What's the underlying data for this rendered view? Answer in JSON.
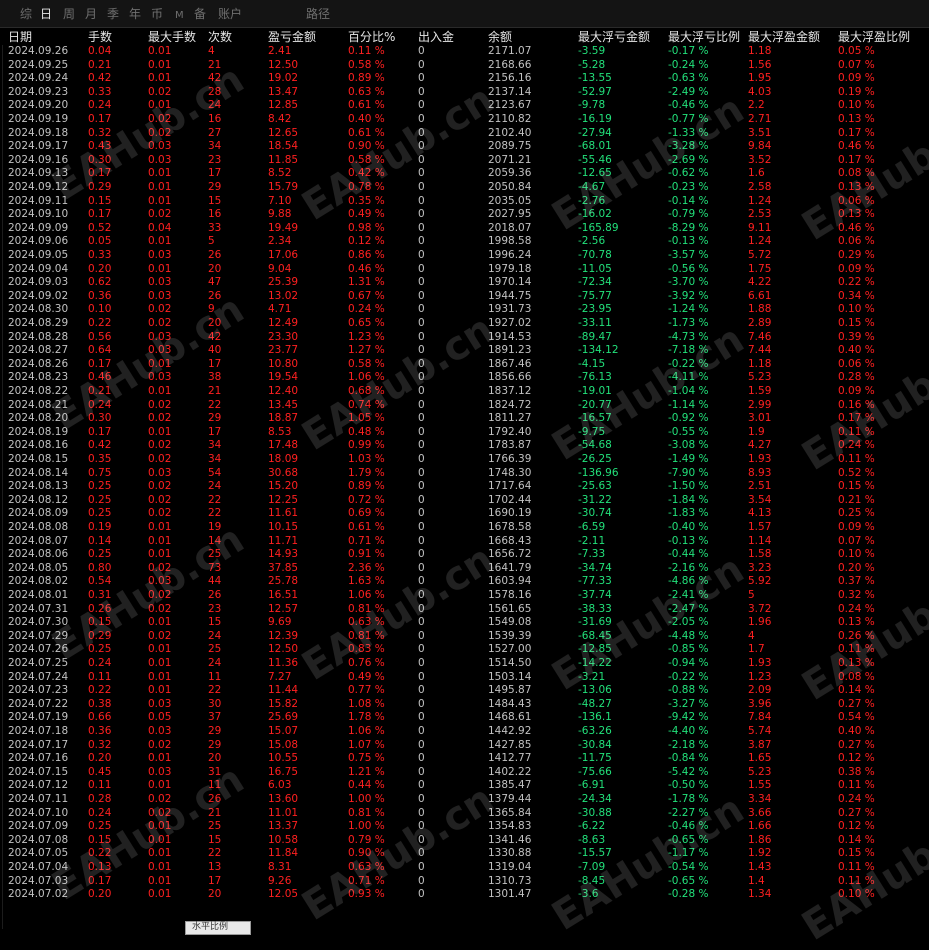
{
  "tabs": [
    {
      "label": "综",
      "name": "tab-summary",
      "active": false,
      "small": false
    },
    {
      "label": "日",
      "name": "tab-day",
      "active": true,
      "small": false
    },
    {
      "label": "周",
      "name": "tab-week",
      "active": false,
      "small": false
    },
    {
      "label": "月",
      "name": "tab-month",
      "active": false,
      "small": false
    },
    {
      "label": "季",
      "name": "tab-quarter",
      "active": false,
      "small": false
    },
    {
      "label": "年",
      "name": "tab-year",
      "active": false,
      "small": false
    },
    {
      "label": "币",
      "name": "tab-currency",
      "active": false,
      "small": false
    },
    {
      "label": "M",
      "name": "tab-m",
      "active": false,
      "small": true
    },
    {
      "label": "备",
      "name": "tab-backup",
      "active": false,
      "small": false
    },
    {
      "label": "账户",
      "name": "tab-account",
      "active": false,
      "small": false
    },
    {
      "label": "路径",
      "name": "tab-path",
      "active": false,
      "small": false
    }
  ],
  "columns": [
    "日期",
    "手数",
    "最大手数",
    "次数",
    "盈亏金额",
    "百分比%",
    "出入金",
    "余额",
    "最大浮亏金额",
    "最大浮亏比例",
    "最大浮盈金额",
    "最大浮盈比例"
  ],
  "watermark": "EAHub.cn",
  "tooltip": "水平比例",
  "colors": {
    "positive": "#ff2020",
    "negative": "#22e07a",
    "neutral": "#c2c2c2",
    "background": "#000000"
  },
  "rows": [
    [
      "2024.09.26",
      "0.04",
      "0.01",
      "4",
      "2.41",
      "0.11 %",
      "0",
      "2171.07",
      "-3.59",
      "-0.17 %",
      "1.18",
      "0.05 %"
    ],
    [
      "2024.09.25",
      "0.21",
      "0.01",
      "21",
      "12.50",
      "0.58 %",
      "0",
      "2168.66",
      "-5.28",
      "-0.24 %",
      "1.56",
      "0.07 %"
    ],
    [
      "2024.09.24",
      "0.42",
      "0.01",
      "42",
      "19.02",
      "0.89 %",
      "0",
      "2156.16",
      "-13.55",
      "-0.63 %",
      "1.95",
      "0.09 %"
    ],
    [
      "2024.09.23",
      "0.33",
      "0.02",
      "28",
      "13.47",
      "0.63 %",
      "0",
      "2137.14",
      "-52.97",
      "-2.49 %",
      "4.03",
      "0.19 %"
    ],
    [
      "2024.09.20",
      "0.24",
      "0.01",
      "24",
      "12.85",
      "0.61 %",
      "0",
      "2123.67",
      "-9.78",
      "-0.46 %",
      "2.2",
      "0.10 %"
    ],
    [
      "2024.09.19",
      "0.17",
      "0.02",
      "16",
      "8.42",
      "0.40 %",
      "0",
      "2110.82",
      "-16.19",
      "-0.77 %",
      "2.71",
      "0.13 %"
    ],
    [
      "2024.09.18",
      "0.32",
      "0.02",
      "27",
      "12.65",
      "0.61 %",
      "0",
      "2102.40",
      "-27.94",
      "-1.33 %",
      "3.51",
      "0.17 %"
    ],
    [
      "2024.09.17",
      "0.43",
      "0.03",
      "34",
      "18.54",
      "0.90 %",
      "0",
      "2089.75",
      "-68.01",
      "-3.28 %",
      "9.84",
      "0.46 %"
    ],
    [
      "2024.09.16",
      "0.30",
      "0.03",
      "23",
      "11.85",
      "0.58 %",
      "0",
      "2071.21",
      "-55.46",
      "-2.69 %",
      "3.52",
      "0.17 %"
    ],
    [
      "2024.09.13",
      "0.17",
      "0.01",
      "17",
      "8.52",
      "0.42 %",
      "0",
      "2059.36",
      "-12.65",
      "-0.62 %",
      "1.6",
      "0.08 %"
    ],
    [
      "2024.09.12",
      "0.29",
      "0.01",
      "29",
      "15.79",
      "0.78 %",
      "0",
      "2050.84",
      "-4.67",
      "-0.23 %",
      "2.58",
      "0.13 %"
    ],
    [
      "2024.09.11",
      "0.15",
      "0.01",
      "15",
      "7.10",
      "0.35 %",
      "0",
      "2035.05",
      "-2.76",
      "-0.14 %",
      "1.24",
      "0.06 %"
    ],
    [
      "2024.09.10",
      "0.17",
      "0.02",
      "16",
      "9.88",
      "0.49 %",
      "0",
      "2027.95",
      "-16.02",
      "-0.79 %",
      "2.53",
      "0.13 %"
    ],
    [
      "2024.09.09",
      "0.52",
      "0.04",
      "33",
      "19.49",
      "0.98 %",
      "0",
      "2018.07",
      "-165.89",
      "-8.29 %",
      "9.11",
      "0.46 %"
    ],
    [
      "2024.09.06",
      "0.05",
      "0.01",
      "5",
      "2.34",
      "0.12 %",
      "0",
      "1998.58",
      "-2.56",
      "-0.13 %",
      "1.24",
      "0.06 %"
    ],
    [
      "2024.09.05",
      "0.33",
      "0.03",
      "26",
      "17.06",
      "0.86 %",
      "0",
      "1996.24",
      "-70.78",
      "-3.57 %",
      "5.72",
      "0.29 %"
    ],
    [
      "2024.09.04",
      "0.20",
      "0.01",
      "20",
      "9.04",
      "0.46 %",
      "0",
      "1979.18",
      "-11.05",
      "-0.56 %",
      "1.75",
      "0.09 %"
    ],
    [
      "2024.09.03",
      "0.62",
      "0.03",
      "47",
      "25.39",
      "1.31 %",
      "0",
      "1970.14",
      "-72.34",
      "-3.70 %",
      "4.22",
      "0.22 %"
    ],
    [
      "2024.09.02",
      "0.36",
      "0.03",
      "26",
      "13.02",
      "0.67 %",
      "0",
      "1944.75",
      "-75.77",
      "-3.92 %",
      "6.61",
      "0.34 %"
    ],
    [
      "2024.08.30",
      "0.10",
      "0.02",
      "9",
      "4.71",
      "0.24 %",
      "0",
      "1931.73",
      "-23.95",
      "-1.24 %",
      "1.88",
      "0.10 %"
    ],
    [
      "2024.08.29",
      "0.22",
      "0.02",
      "20",
      "12.49",
      "0.65 %",
      "0",
      "1927.02",
      "-33.11",
      "-1.73 %",
      "2.89",
      "0.15 %"
    ],
    [
      "2024.08.28",
      "0.56",
      "0.03",
      "42",
      "23.30",
      "1.23 %",
      "0",
      "1914.53",
      "-89.47",
      "-4.73 %",
      "7.46",
      "0.39 %"
    ],
    [
      "2024.08.27",
      "0.64",
      "0.03",
      "40",
      "23.77",
      "1.27 %",
      "0",
      "1891.23",
      "-134.12",
      "-7.18 %",
      "7.44",
      "0.40 %"
    ],
    [
      "2024.08.26",
      "0.17",
      "0.01",
      "17",
      "10.80",
      "0.58 %",
      "0",
      "1867.46",
      "-4.15",
      "-0.22 %",
      "1.18",
      "0.06 %"
    ],
    [
      "2024.08.23",
      "0.46",
      "0.03",
      "38",
      "19.54",
      "1.06 %",
      "0",
      "1856.66",
      "-76.13",
      "-4.11 %",
      "5.23",
      "0.28 %"
    ],
    [
      "2024.08.22",
      "0.21",
      "0.01",
      "21",
      "12.40",
      "0.68 %",
      "0",
      "1837.12",
      "-19.01",
      "-1.04 %",
      "1.59",
      "0.09 %"
    ],
    [
      "2024.08.21",
      "0.24",
      "0.02",
      "22",
      "13.45",
      "0.74 %",
      "0",
      "1824.72",
      "-20.77",
      "-1.14 %",
      "2.99",
      "0.16 %"
    ],
    [
      "2024.08.20",
      "0.30",
      "0.02",
      "29",
      "18.87",
      "1.05 %",
      "0",
      "1811.27",
      "-16.57",
      "-0.92 %",
      "3.01",
      "0.17 %"
    ],
    [
      "2024.08.19",
      "0.17",
      "0.01",
      "17",
      "8.53",
      "0.48 %",
      "0",
      "1792.40",
      "-9.75",
      "-0.55 %",
      "1.9",
      "0.11 %"
    ],
    [
      "2024.08.16",
      "0.42",
      "0.02",
      "34",
      "17.48",
      "0.99 %",
      "0",
      "1783.87",
      "-54.68",
      "-3.08 %",
      "4.27",
      "0.24 %"
    ],
    [
      "2024.08.15",
      "0.35",
      "0.02",
      "34",
      "18.09",
      "1.03 %",
      "0",
      "1766.39",
      "-26.25",
      "-1.49 %",
      "1.93",
      "0.11 %"
    ],
    [
      "2024.08.14",
      "0.75",
      "0.03",
      "54",
      "30.68",
      "1.79 %",
      "0",
      "1748.30",
      "-136.96",
      "-7.90 %",
      "8.93",
      "0.52 %"
    ],
    [
      "2024.08.13",
      "0.25",
      "0.02",
      "24",
      "15.20",
      "0.89 %",
      "0",
      "1717.64",
      "-25.63",
      "-1.50 %",
      "2.51",
      "0.15 %"
    ],
    [
      "2024.08.12",
      "0.25",
      "0.02",
      "22",
      "12.25",
      "0.72 %",
      "0",
      "1702.44",
      "-31.22",
      "-1.84 %",
      "3.54",
      "0.21 %"
    ],
    [
      "2024.08.09",
      "0.25",
      "0.02",
      "22",
      "11.61",
      "0.69 %",
      "0",
      "1690.19",
      "-30.74",
      "-1.83 %",
      "4.13",
      "0.25 %"
    ],
    [
      "2024.08.08",
      "0.19",
      "0.01",
      "19",
      "10.15",
      "0.61 %",
      "0",
      "1678.58",
      "-6.59",
      "-0.40 %",
      "1.57",
      "0.09 %"
    ],
    [
      "2024.08.07",
      "0.14",
      "0.01",
      "14",
      "11.71",
      "0.71 %",
      "0",
      "1668.43",
      "-2.11",
      "-0.13 %",
      "1.14",
      "0.07 %"
    ],
    [
      "2024.08.06",
      "0.25",
      "0.01",
      "25",
      "14.93",
      "0.91 %",
      "0",
      "1656.72",
      "-7.33",
      "-0.44 %",
      "1.58",
      "0.10 %"
    ],
    [
      "2024.08.05",
      "0.80",
      "0.02",
      "73",
      "37.85",
      "2.36 %",
      "0",
      "1641.79",
      "-34.74",
      "-2.16 %",
      "3.23",
      "0.20 %"
    ],
    [
      "2024.08.02",
      "0.54",
      "0.03",
      "44",
      "25.78",
      "1.63 %",
      "0",
      "1603.94",
      "-77.33",
      "-4.86 %",
      "5.92",
      "0.37 %"
    ],
    [
      "2024.08.01",
      "0.31",
      "0.02",
      "26",
      "16.51",
      "1.06 %",
      "0",
      "1578.16",
      "-37.74",
      "-2.41 %",
      "5",
      "0.32 %"
    ],
    [
      "2024.07.31",
      "0.26",
      "0.02",
      "23",
      "12.57",
      "0.81 %",
      "0",
      "1561.65",
      "-38.33",
      "-2.47 %",
      "3.72",
      "0.24 %"
    ],
    [
      "2024.07.30",
      "0.15",
      "0.01",
      "15",
      "9.69",
      "0.63 %",
      "0",
      "1549.08",
      "-31.69",
      "-2.05 %",
      "1.96",
      "0.13 %"
    ],
    [
      "2024.07.29",
      "0.29",
      "0.02",
      "24",
      "12.39",
      "0.81 %",
      "0",
      "1539.39",
      "-68.45",
      "-4.48 %",
      "4",
      "0.26 %"
    ],
    [
      "2024.07.26",
      "0.25",
      "0.01",
      "25",
      "12.50",
      "0.83 %",
      "0",
      "1527.00",
      "-12.85",
      "-0.85 %",
      "1.7",
      "0.11 %"
    ],
    [
      "2024.07.25",
      "0.24",
      "0.01",
      "24",
      "11.36",
      "0.76 %",
      "0",
      "1514.50",
      "-14.22",
      "-0.94 %",
      "1.93",
      "0.13 %"
    ],
    [
      "2024.07.24",
      "0.11",
      "0.01",
      "11",
      "7.27",
      "0.49 %",
      "0",
      "1503.14",
      "-3.21",
      "-0.22 %",
      "1.23",
      "0.08 %"
    ],
    [
      "2024.07.23",
      "0.22",
      "0.01",
      "22",
      "11.44",
      "0.77 %",
      "0",
      "1495.87",
      "-13.06",
      "-0.88 %",
      "2.09",
      "0.14 %"
    ],
    [
      "2024.07.22",
      "0.38",
      "0.03",
      "30",
      "15.82",
      "1.08 %",
      "0",
      "1484.43",
      "-48.27",
      "-3.27 %",
      "3.96",
      "0.27 %"
    ],
    [
      "2024.07.19",
      "0.66",
      "0.05",
      "37",
      "25.69",
      "1.78 %",
      "0",
      "1468.61",
      "-136.1",
      "-9.42 %",
      "7.84",
      "0.54 %"
    ],
    [
      "2024.07.18",
      "0.36",
      "0.03",
      "29",
      "15.07",
      "1.06 %",
      "0",
      "1442.92",
      "-63.26",
      "-4.40 %",
      "5.74",
      "0.40 %"
    ],
    [
      "2024.07.17",
      "0.32",
      "0.02",
      "29",
      "15.08",
      "1.07 %",
      "0",
      "1427.85",
      "-30.84",
      "-2.18 %",
      "3.87",
      "0.27 %"
    ],
    [
      "2024.07.16",
      "0.20",
      "0.01",
      "20",
      "10.55",
      "0.75 %",
      "0",
      "1412.77",
      "-11.75",
      "-0.84 %",
      "1.65",
      "0.12 %"
    ],
    [
      "2024.07.15",
      "0.45",
      "0.03",
      "31",
      "16.75",
      "1.21 %",
      "0",
      "1402.22",
      "-75.66",
      "-5.42 %",
      "5.23",
      "0.38 %"
    ],
    [
      "2024.07.12",
      "0.11",
      "0.01",
      "11",
      "6.03",
      "0.44 %",
      "0",
      "1385.47",
      "-6.91",
      "-0.50 %",
      "1.55",
      "0.11 %"
    ],
    [
      "2024.07.11",
      "0.28",
      "0.02",
      "26",
      "13.60",
      "1.00 %",
      "0",
      "1379.44",
      "-24.34",
      "-1.78 %",
      "3.34",
      "0.24 %"
    ],
    [
      "2024.07.10",
      "0.24",
      "0.02",
      "21",
      "11.01",
      "0.81 %",
      "0",
      "1365.84",
      "-30.88",
      "-2.27 %",
      "3.66",
      "0.27 %"
    ],
    [
      "2024.07.09",
      "0.25",
      "0.01",
      "25",
      "13.37",
      "1.00 %",
      "0",
      "1354.83",
      "-6.22",
      "-0.46 %",
      "1.66",
      "0.12 %"
    ],
    [
      "2024.07.08",
      "0.15",
      "0.01",
      "15",
      "10.58",
      "0.79 %",
      "0",
      "1341.46",
      "-8.63",
      "-0.65 %",
      "1.86",
      "0.14 %"
    ],
    [
      "2024.07.05",
      "0.22",
      "0.01",
      "22",
      "11.84",
      "0.90 %",
      "0",
      "1330.88",
      "-15.57",
      "-1.17 %",
      "1.92",
      "0.15 %"
    ],
    [
      "2024.07.04",
      "0.13",
      "0.01",
      "13",
      "8.31",
      "0.63 %",
      "0",
      "1319.04",
      "-7.09",
      "-0.54 %",
      "1.43",
      "0.11 %"
    ],
    [
      "2024.07.03",
      "0.17",
      "0.01",
      "17",
      "9.26",
      "0.71 %",
      "0",
      "1310.73",
      "-8.45",
      "-0.65 %",
      "1.4",
      "0.11 %"
    ],
    [
      "2024.07.02",
      "0.20",
      "0.01",
      "20",
      "12.05",
      "0.93 %",
      "0",
      "1301.47",
      "-3.6",
      "-0.28 %",
      "1.34",
      "0.10 %"
    ]
  ]
}
